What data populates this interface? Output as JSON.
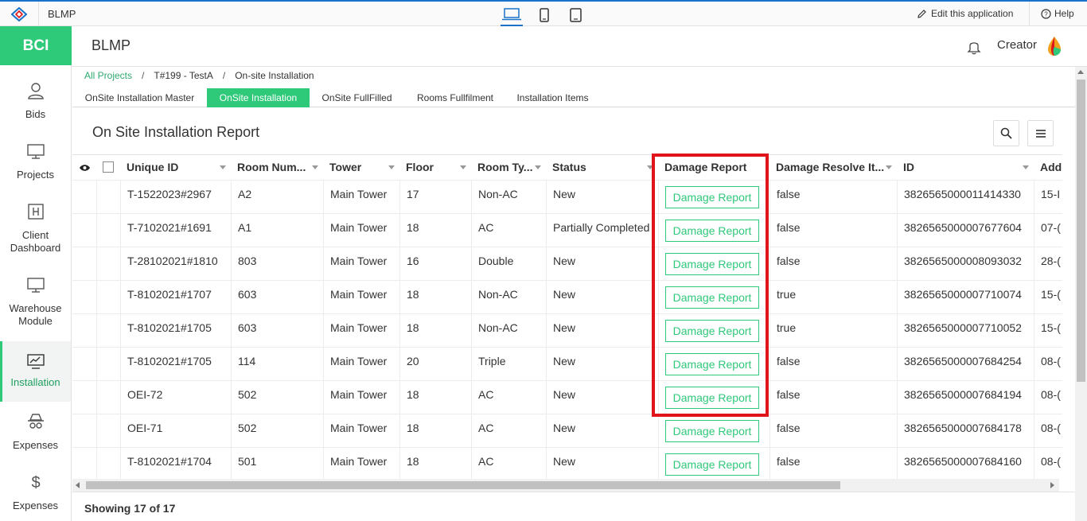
{
  "app": {
    "name": "BLMP",
    "edit_label": "Edit this application",
    "help_label": "Help"
  },
  "colors": {
    "accent": "#2fc97a",
    "brand_blue": "#1a73c9",
    "highlight": "#e0141b"
  },
  "sidebar": {
    "brand": "BCI",
    "items": [
      {
        "line1": "Bids",
        "line2": "",
        "icon": "user-icon"
      },
      {
        "line1": "Projects",
        "line2": "",
        "icon": "monitor-icon"
      },
      {
        "line1": "Client",
        "line2": "Dashboard",
        "icon": "dashboard-icon"
      },
      {
        "line1": "Warehouse",
        "line2": "Module",
        "icon": "monitor-icon"
      },
      {
        "line1": "Installation",
        "line2": "",
        "icon": "chart-icon"
      },
      {
        "line1": "Expenses",
        "line2": "",
        "icon": "incognito-icon"
      },
      {
        "line1": "Expenses",
        "line2": "",
        "icon": "dollar-icon"
      }
    ]
  },
  "header": {
    "title": "BLMP",
    "user": "Creator"
  },
  "breadcrumb": {
    "root": "All Projects",
    "project": "T#199 - TestA",
    "current": "On-site Installation"
  },
  "tabs": [
    "OnSite Installation Master",
    "OnSite Installation",
    "OnSite FullFilled",
    "Rooms Fullfilment",
    "Installation Items"
  ],
  "report": {
    "title": "On Site Installation Report",
    "footer": "Showing 17 of 17"
  },
  "table": {
    "columns": [
      "Unique ID",
      "Room Num...",
      "Tower",
      "Floor",
      "Room Ty...",
      "Status",
      "Damage Report",
      "Damage Resolve It...",
      "ID",
      "Add"
    ],
    "button_label": "Damage Report",
    "rows": [
      {
        "uid": "T-1522023#2967",
        "room": "A2",
        "tower": "Main Tower",
        "floor": "17",
        "type": "Non-AC",
        "status": "New",
        "resolve": "false",
        "id": "3826565000011414330",
        "add": "15-I"
      },
      {
        "uid": "T-7102021#1691",
        "room": "A1",
        "tower": "Main Tower",
        "floor": "18",
        "type": "AC",
        "status": "Partially Completed",
        "resolve": "false",
        "id": "3826565000007677604",
        "add": "07-("
      },
      {
        "uid": "T-28102021#1810",
        "room": "803",
        "tower": "Main Tower",
        "floor": "16",
        "type": "Double",
        "status": "New",
        "resolve": "false",
        "id": "3826565000008093032",
        "add": "28-("
      },
      {
        "uid": "T-8102021#1707",
        "room": "603",
        "tower": "Main Tower",
        "floor": "18",
        "type": "Non-AC",
        "status": "New",
        "resolve": "true",
        "id": "3826565000007710074",
        "add": "15-("
      },
      {
        "uid": "T-8102021#1705",
        "room": "603",
        "tower": "Main Tower",
        "floor": "18",
        "type": "Non-AC",
        "status": "New",
        "resolve": "true",
        "id": "3826565000007710052",
        "add": "15-("
      },
      {
        "uid": "T-8102021#1705",
        "room": "114",
        "tower": "Main Tower",
        "floor": "20",
        "type": "Triple",
        "status": "New",
        "resolve": "false",
        "id": "3826565000007684254",
        "add": "08-("
      },
      {
        "uid": "OEI-72",
        "room": "502",
        "tower": "Main Tower",
        "floor": "18",
        "type": "AC",
        "status": "New",
        "resolve": "false",
        "id": "3826565000007684194",
        "add": "08-("
      },
      {
        "uid": "OEI-71",
        "room": "502",
        "tower": "Main Tower",
        "floor": "18",
        "type": "AC",
        "status": "New",
        "resolve": "false",
        "id": "3826565000007684178",
        "add": "08-("
      },
      {
        "uid": "T-8102021#1704",
        "room": "501",
        "tower": "Main Tower",
        "floor": "18",
        "type": "AC",
        "status": "New",
        "resolve": "false",
        "id": "3826565000007684160",
        "add": "08-("
      }
    ]
  }
}
